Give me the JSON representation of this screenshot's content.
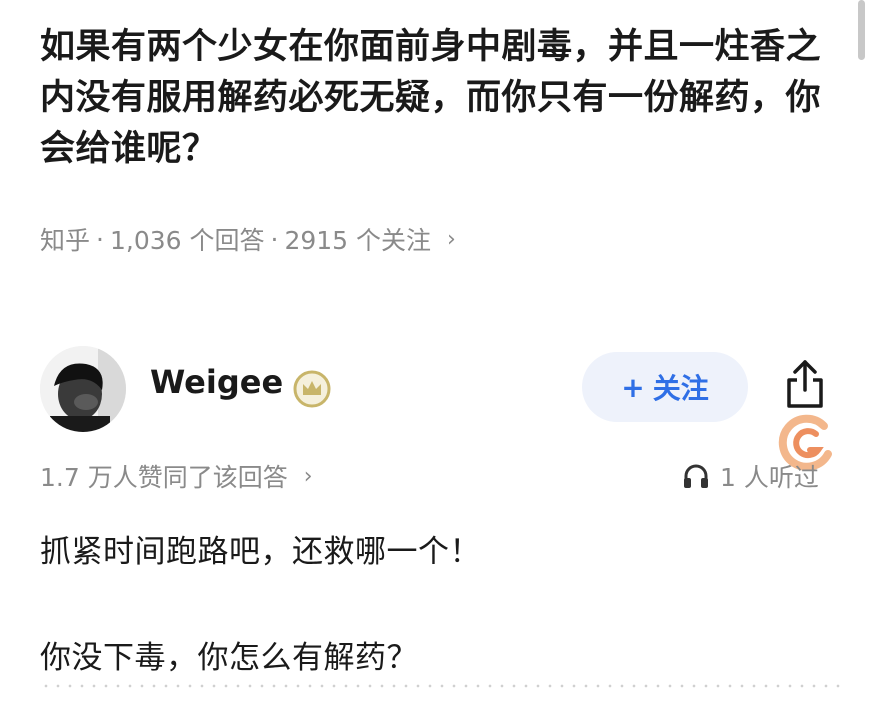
{
  "question": {
    "title": "如果有两个少女在你面前身中剧毒，并且一炷香之内没有服用解药必死无疑，而你只有一份解药，你会给谁呢？",
    "source": "知乎",
    "separator": "·",
    "answers_count": "1,036 个回答",
    "followers_count": "2915 个关注",
    "chevron": "›"
  },
  "author": {
    "name": "Weigee",
    "follow_label": "关注",
    "follow_plus": "+"
  },
  "answer": {
    "likes_text": "1.7 万人赞同了该回答",
    "chevron": "›",
    "listen_text": "1 人听过",
    "lines": [
      "抓紧时间跑路吧，还救哪一个！",
      "你没下毒，你怎么有解药？"
    ]
  },
  "colors": {
    "accent": "#2f6fe6",
    "follow_bg": "#eef2fb",
    "muted": "#8a8a8a",
    "badge": "#c8b56a"
  },
  "icons": [
    "share-icon",
    "headphone-icon",
    "badge-icon",
    "plus-icon",
    "watermark-logo"
  ]
}
